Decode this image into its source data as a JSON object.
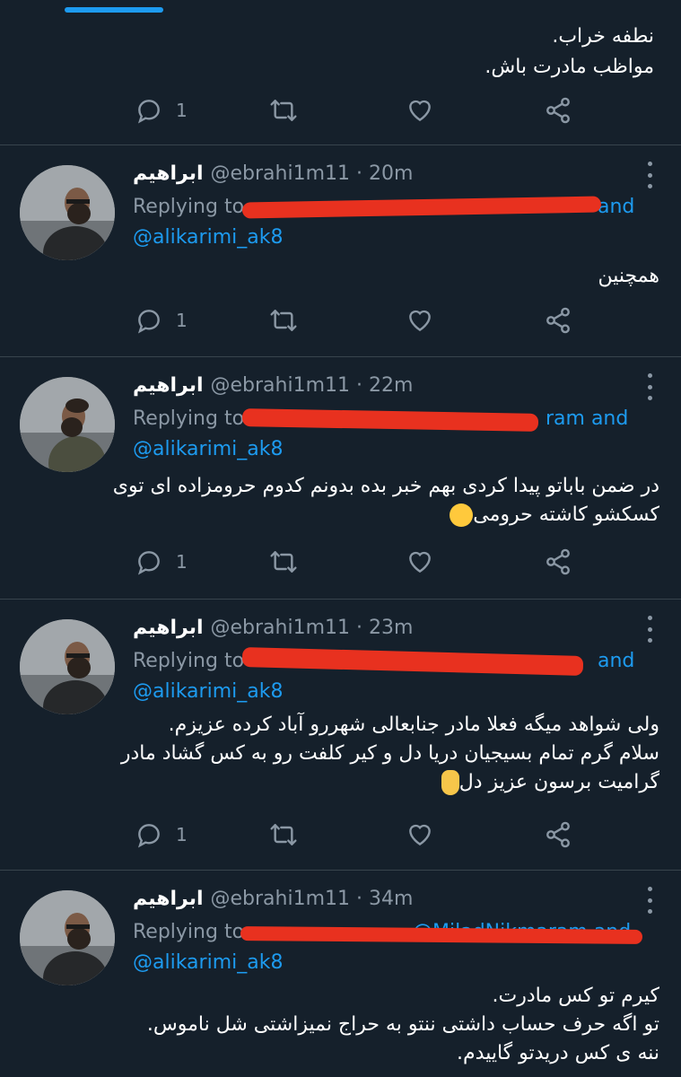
{
  "first_tweet": {
    "lines": [
      "نطفه خراب.",
      "مواظب مادرت باش."
    ],
    "reply_count": "1"
  },
  "tweets": [
    {
      "name": "ابراهیم",
      "handle": "@ebrahi1m11 · 20m",
      "replying_to": "Replying to",
      "replying_suffix": "and",
      "mention": "@alikarimi_ak8",
      "lines": [
        "همچنین"
      ],
      "reply_count": "1"
    },
    {
      "name": "ابراهیم",
      "handle": "@ebrahi1m11 · 22m",
      "replying_to": "Replying to",
      "replying_suffix": "ram and",
      "mention": "@alikarimi_ak8",
      "lines": [
        "در ضمن باباتو پیدا کردی بهم خبر بده بدونم کدوم حرومزاده ای توی",
        "کسکشو کاشته حرومی"
      ],
      "reply_count": "1"
    },
    {
      "name": "ابراهیم",
      "handle": "@ebrahi1m11 · 23m",
      "replying_to": "Replying to",
      "replying_suffix": "and",
      "mention": "@alikarimi_ak8",
      "lines": [
        "ولی شواهد میگه فعلا مادر جنابعالی شهررو آباد کرده عزیزم.",
        "سلام گرم تمام بسیجیان دریا دل و کیر کلفت رو به کس گشاد مادر",
        "گرامیت برسون عزیز دل"
      ],
      "reply_count": "1"
    },
    {
      "name": "ابراهیم",
      "handle": "@ebrahi1m11 · 34m",
      "replying_to": "Replying to",
      "replying_suffix": "@MiladNikmaram and",
      "mention": "@alikarimi_ak8",
      "lines": [
        "کیرم تو کس مادرت.",
        "تو اگه حرف حساب داشتی ننتو به حراج نمیزاشتی شل ناموس.",
        "ننه ی کس دریدتو گاییدم."
      ],
      "reply_count": ""
    }
  ],
  "icons": {
    "reply": "reply-icon",
    "retweet": "retweet-icon",
    "like": "heart-icon",
    "share": "share-icon",
    "more": "more-icon"
  },
  "colors": {
    "background": "#15202b",
    "accent": "#1d9bf0",
    "muted": "#8b98a5",
    "redaction": "#e8311f"
  }
}
